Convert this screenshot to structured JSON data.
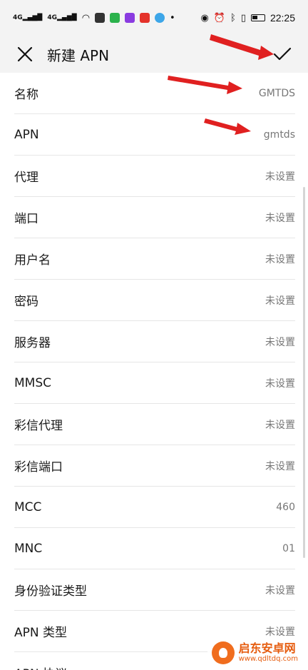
{
  "status_bar": {
    "signal1": "4G",
    "signal2": "4G",
    "time": "22:25"
  },
  "header": {
    "title": "新建 APN"
  },
  "fields": [
    {
      "label": "名称",
      "value": "GMTDS"
    },
    {
      "label": "APN",
      "value": "gmtds"
    },
    {
      "label": "代理",
      "value": "未设置"
    },
    {
      "label": "端口",
      "value": "未设置"
    },
    {
      "label": "用户名",
      "value": "未设置"
    },
    {
      "label": "密码",
      "value": "未设置"
    },
    {
      "label": "服务器",
      "value": "未设置"
    },
    {
      "label": "MMSC",
      "value": "未设置"
    },
    {
      "label": "彩信代理",
      "value": "未设置"
    },
    {
      "label": "彩信端口",
      "value": "未设置"
    },
    {
      "label": "MCC",
      "value": "460"
    },
    {
      "label": "MNC",
      "value": "01"
    },
    {
      "label": "身份验证类型",
      "value": "未设置"
    },
    {
      "label": "APN 类型",
      "value": "未设置"
    },
    {
      "label": "APN 协议",
      "value": ""
    }
  ],
  "watermark": {
    "title": "启东安卓网",
    "url": "www.qdltdq.com"
  },
  "colors": {
    "annotation_arrow": "#e02020",
    "header_bg": "#f3f3f3",
    "list_bg": "#ffffff"
  }
}
